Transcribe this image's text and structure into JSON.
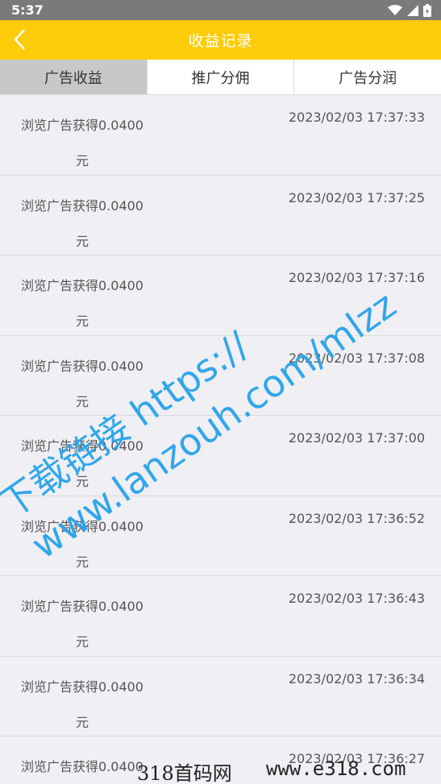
{
  "status_bar": {
    "time": "5:37"
  },
  "app_bar": {
    "title": "收益记录"
  },
  "tabs": [
    {
      "label": "广告收益",
      "active": true
    },
    {
      "label": "推广分佣",
      "active": false
    },
    {
      "label": "广告分润",
      "active": false
    }
  ],
  "records": [
    {
      "desc": "浏览广告获得0.0400元",
      "time": "2023/02/03 17:37:33"
    },
    {
      "desc": "浏览广告获得0.0400元",
      "time": "2023/02/03 17:37:25"
    },
    {
      "desc": "浏览广告获得0.0400元",
      "time": "2023/02/03 17:37:16"
    },
    {
      "desc": "浏览广告获得0.0400元",
      "time": "2023/02/03 17:37:08"
    },
    {
      "desc": "浏览广告获得0.0400元",
      "time": "2023/02/03 17:37:00"
    },
    {
      "desc": "浏览广告获得0.0400元",
      "time": "2023/02/03 17:36:52"
    },
    {
      "desc": "浏览广告获得0.0400元",
      "time": "2023/02/03 17:36:43"
    },
    {
      "desc": "浏览广告获得0.0400元",
      "time": "2023/02/03 17:36:34"
    },
    {
      "desc": "浏览广告获得0.0400",
      "time": "2023/02/03 17:36:27"
    }
  ],
  "watermark": {
    "line1": "下载链接 https://",
    "line2": "www.lanzouh.com/mlzz",
    "footer_left": "318首码网",
    "footer_right": "www.e318.com"
  },
  "colors": {
    "accent": "#fecc0a",
    "watermark": "#27a3ea",
    "status_bar": "#7a7a7a"
  }
}
